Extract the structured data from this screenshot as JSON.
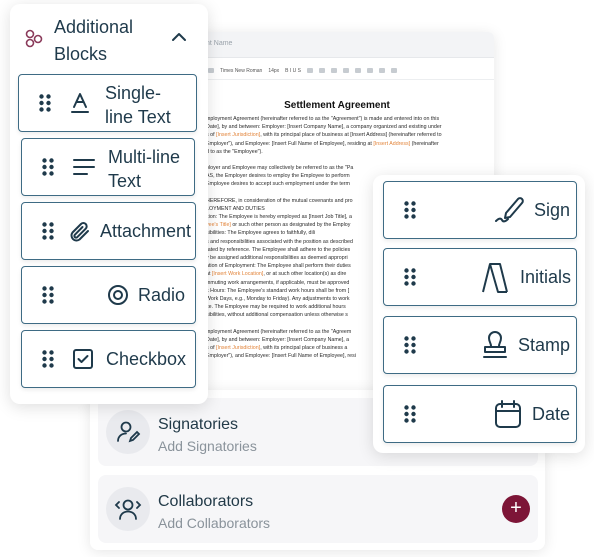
{
  "document": {
    "name_placeholder": "nt Name",
    "toolbar": {
      "font_family": "Times New Roman",
      "font_size": "14px",
      "format_marks": "B I U S"
    },
    "title": "Settlement Agreement",
    "lines": [
      {
        "before": "mployment Agreement (hereinafter referred to as the \"Agreement\") is made and entered into on this",
        "hl": "",
        "after": ""
      },
      {
        "before": "Date], by and between: Employer: [Insert Company Name], a company organized and existing under",
        "hl": "",
        "after": ""
      },
      {
        "before": "s of ",
        "hl": "[Insert Jurisdiction]",
        "after": ", with its principal place of business at [Insert Address] (hereinafter referred to"
      },
      {
        "before": "Employer\"), and Employee: [Insert Full Name of Employee], residing at ",
        "hl": "[Insert Address]",
        "after": " (hereinafter"
      },
      {
        "before": "d to as the \"Employee\").",
        "hl": "",
        "after": ""
      },
      {
        "gap": true
      },
      {
        "before": "ployer and Employee may collectively be referred to as the \"Pa",
        "hl": "",
        "after": ""
      },
      {
        "before": "AS, the Employer desires to employ the Employee to perform",
        "hl": "",
        "after": ""
      },
      {
        "before": "Employee desires to accept such employment under the term",
        "hl": "",
        "after": ""
      },
      {
        "gap": true
      },
      {
        "before": "HEREFORE, in consideration of the mutual covenants and pro",
        "hl": "",
        "after": ""
      },
      {
        "before": "LOYMENT AND DUTIES",
        "hl": "",
        "after": ""
      },
      {
        "before": "ition: The Employee is hereby employed as [Insert Job Title], a",
        "hl": "",
        "after": ""
      },
      {
        "before": "",
        "hl": "yee's Title]",
        "after": " or such other person as designated by the Employ"
      },
      {
        "before": "sibilities: The Employee agrees to faithfully, dili",
        "hl": "",
        "after": ""
      },
      {
        "before": "s and responsibilities associated with the position as described",
        "hl": "",
        "after": ""
      },
      {
        "before": "rated by reference. The Employee shall adhere to the policies",
        "hl": "",
        "after": ""
      },
      {
        "before": "y be assigned additional responsibilities as deemed appropri",
        "hl": "",
        "after": ""
      },
      {
        "before": "ation of Employment: The Employee shall perform their duties",
        "hl": "",
        "after": ""
      },
      {
        "before": "at ",
        "hl": "[Insert Work Location]",
        "after": ", or at such other location(s) as dire"
      },
      {
        "before": "mmuting work arrangements, if applicable, must be approved",
        "hl": "",
        "after": ""
      },
      {
        "before": "k Hours: The Employee's standard work hours shall be from [",
        "hl": "",
        "after": ""
      },
      {
        "before": "Work Days, e.g., Monday to Friday). Any adjustments to work",
        "hl": "",
        "after": ""
      },
      {
        "before": "ce. The Employee may be required to work additional hours",
        "hl": "",
        "after": ""
      },
      {
        "before": "sibilities, without additional compensation unless otherwise s",
        "hl": "",
        "after": ""
      },
      {
        "gap": true
      },
      {
        "before": "mployment Agreement (hereinafter referred to as the \"Agreem",
        "hl": "",
        "after": ""
      },
      {
        "before": "Date], by and between: Employer: [Insert Company Name], a",
        "hl": "",
        "after": ""
      },
      {
        "before": "s of ",
        "hl": "[Insert Jurisdiction]",
        "after": ", with its principal place of business a"
      },
      {
        "before": "Employer\"), and Employee: [Insert Full Name of Employee], resi",
        "hl": "",
        "after": ""
      }
    ]
  },
  "blocks_panel": {
    "title": "Additional Blocks",
    "items": [
      {
        "label": "Single-line Text",
        "icon": "text-a-icon"
      },
      {
        "label": "Multi-line Text",
        "icon": "lines-icon"
      },
      {
        "label": "Attachment",
        "icon": "paperclip-icon"
      },
      {
        "label": "Radio",
        "icon": "radio-icon"
      },
      {
        "label": "Checkbox",
        "icon": "checkbox-icon"
      }
    ]
  },
  "sign_panel": {
    "items": [
      {
        "label": "Sign",
        "icon": "pen-signature-icon"
      },
      {
        "label": "Initials",
        "icon": "initials-icon"
      },
      {
        "label": "Stamp",
        "icon": "stamp-icon"
      },
      {
        "label": "Date",
        "icon": "calendar-icon"
      }
    ]
  },
  "people": {
    "signatories": {
      "title": "Signatories",
      "subtitle": "Add Signatories"
    },
    "collaborators": {
      "title": "Collaborators",
      "subtitle": "Add Collaborators",
      "add_button": "+"
    }
  },
  "colors": {
    "accent_border": "#3e6b84",
    "text_primary": "#1f3a4b",
    "add_button_bg": "#7d1537",
    "placeholder_highlight": "#e2843a"
  }
}
